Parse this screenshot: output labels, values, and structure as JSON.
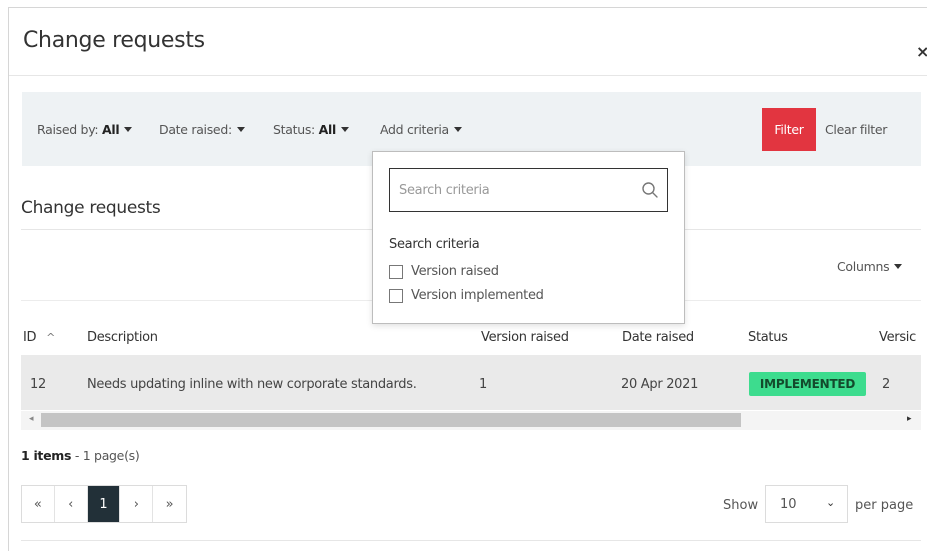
{
  "modal": {
    "title": "Change requests",
    "close_icon": "close-icon",
    "close_glyph": "×"
  },
  "filterbar": {
    "raised_by_label": "Raised by:",
    "raised_by_value": "All",
    "date_raised_label": "Date raised:",
    "status_label": "Status:",
    "status_value": "All",
    "add_criteria_label": "Add criteria",
    "filter_button": "Filter",
    "clear_filter": "Clear filter",
    "filter_button_color": "#e23540"
  },
  "dropdown": {
    "search_placeholder": "Search criteria",
    "heading": "Search criteria",
    "options": [
      {
        "label": "Version raised",
        "checked": false
      },
      {
        "label": "Version implemented",
        "checked": false
      }
    ]
  },
  "section": {
    "title": "Change requests",
    "columns_button": "Columns"
  },
  "table": {
    "headers": {
      "id": "ID",
      "id_sort_glyph": "^",
      "description": "Description",
      "version_raised": "Version raised",
      "date_raised": "Date raised",
      "status": "Status",
      "version_implemented": "Versic"
    },
    "rows": [
      {
        "id": "12",
        "description": "Needs updating inline with new corporate standards.",
        "version_raised": "1",
        "date_raised": "20 Apr 2021",
        "status": "IMPLEMENTED",
        "version_implemented": "2"
      }
    ],
    "status_color": "#3ddc8e"
  },
  "scrollbar": {
    "left_glyph": "◂",
    "right_glyph": "▸"
  },
  "footer": {
    "items_count": "1 items",
    "pages_text": "- 1 page(s)",
    "pager": {
      "first": "«",
      "prev": "‹",
      "current": "1",
      "next": "›",
      "last": "»"
    },
    "show_label": "Show",
    "per_page_value": "10",
    "per_page_chevron": "⌄",
    "per_page_label": "per page"
  }
}
